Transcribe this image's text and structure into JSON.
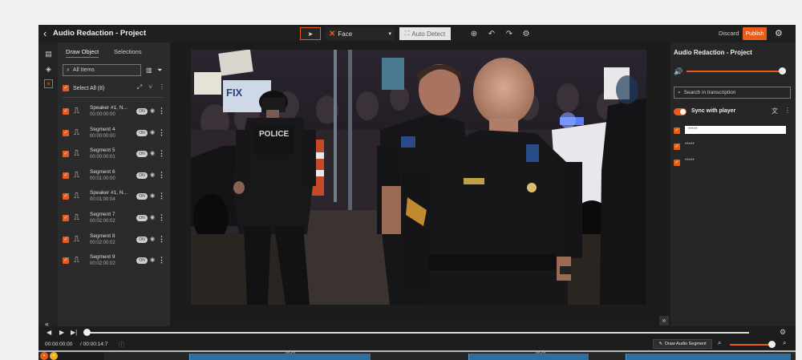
{
  "header": {
    "back_icon": "back-arrow-icon",
    "title": "Audio Redaction - Project",
    "tool_select": "Face",
    "auto_detect": "Auto Detect",
    "discard": "Discard",
    "publish": "Publish"
  },
  "left_panel": {
    "tabs": [
      "Draw Object",
      "Selections"
    ],
    "search_placeholder": "All Items",
    "select_all": "Select All (8)",
    "segments": [
      {
        "name": "Speaker #1, N...",
        "time": "00:00:00:00"
      },
      {
        "name": "Segment 4",
        "time": "00:00:00:00"
      },
      {
        "name": "Segment 5",
        "time": "00:00:00:01"
      },
      {
        "name": "Segment 6",
        "time": "00:01:00:00"
      },
      {
        "name": "Speaker #1, N...",
        "time": "00:01:00:04"
      },
      {
        "name": "Segment 7",
        "time": "00:02:00:02"
      },
      {
        "name": "Segment 8",
        "time": "00:02:00:02"
      },
      {
        "name": "Segment 9",
        "time": "00:02:00:02"
      }
    ],
    "toggle_label": "ON"
  },
  "right_panel": {
    "title": "Audio Redaction - Project",
    "search_placeholder": "Search in transcription",
    "sync_label": "Sync with player",
    "volume_level": 0.96,
    "transcript": [
      {
        "word": "*****",
        "highlighted": true
      },
      {
        "word": "*****",
        "highlighted": false
      },
      {
        "word": "*****",
        "highlighted": false
      }
    ]
  },
  "controls": {
    "current_time": "00:00:00:00",
    "duration": "/ 00:00:14:7",
    "draw_segment": "Draw Audio Segment",
    "zoom_level": 0.92,
    "tick_labels": [
      "00:01",
      "00:02"
    ]
  },
  "video": {
    "police_text": "POLICE",
    "sign_text": "FIX"
  },
  "colors": {
    "accent": "#e85c1a",
    "segment": "#2f6f9f"
  }
}
